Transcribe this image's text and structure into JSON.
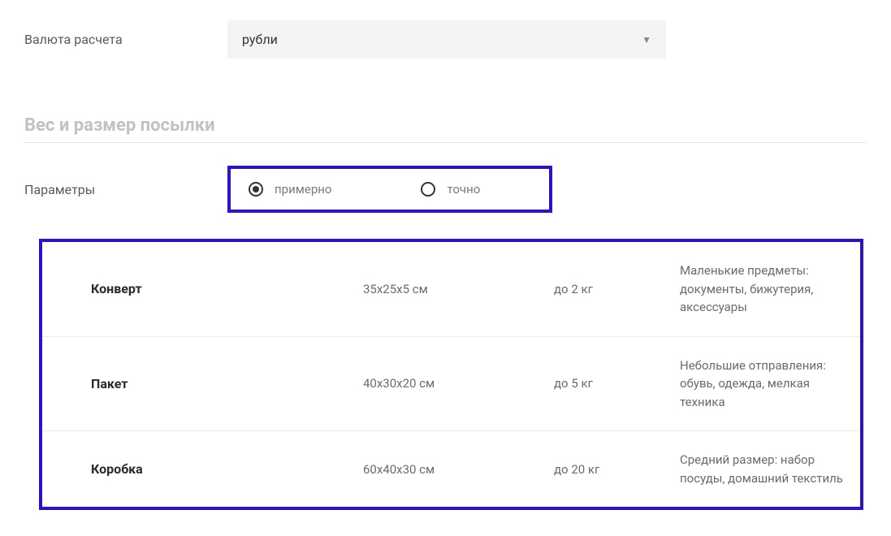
{
  "currency": {
    "label": "Валюта расчета",
    "selected": "рубли"
  },
  "section_title": "Вес и размер посылки",
  "parameters": {
    "label": "Параметры",
    "options": [
      {
        "label": "примерно",
        "selected": true
      },
      {
        "label": "точно",
        "selected": false
      }
    ]
  },
  "package_types": [
    {
      "name": "Конверт",
      "dimensions": "35х25х5 см",
      "weight": "до 2 кг",
      "description": "Маленькие предметы: документы, бижутерия, аксессуары"
    },
    {
      "name": "Пакет",
      "dimensions": "40х30х20 см",
      "weight": "до 5 кг",
      "description": "Небольшие отправления: обувь, одежда, мелкая техника"
    },
    {
      "name": "Коробка",
      "dimensions": "60х40х30 см",
      "weight": "до 20 кг",
      "description": "Средний размер: набор посуды, домашний текстиль"
    }
  ]
}
